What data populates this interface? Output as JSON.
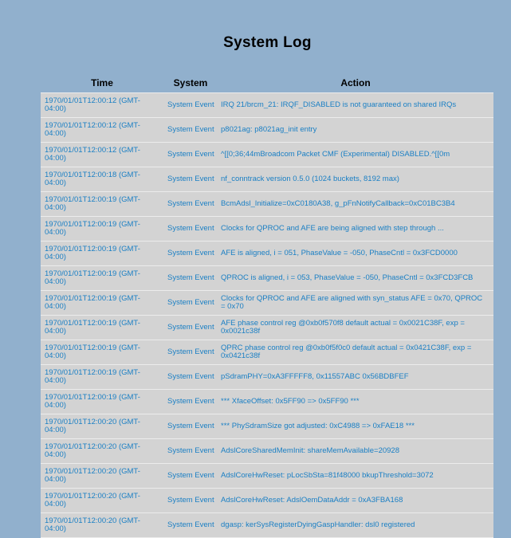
{
  "page": {
    "title": "System Log"
  },
  "table": {
    "headers": {
      "time": "Time",
      "system": "System",
      "action": "Action"
    },
    "rows": [
      {
        "time": "1970/01/01T12:00:12 (GMT-04:00)",
        "system": "System Event",
        "action": "IRQ 21/brcm_21: IRQF_DISABLED is not guaranteed on shared IRQs"
      },
      {
        "time": "1970/01/01T12:00:12 (GMT-04:00)",
        "system": "System Event",
        "action": "p8021ag: p8021ag_init entry"
      },
      {
        "time": "1970/01/01T12:00:12 (GMT-04:00)",
        "system": "System Event",
        "action": "^[[0;36;44mBroadcom Packet CMF (Experimental) DISABLED.^[[0m"
      },
      {
        "time": "1970/01/01T12:00:18 (GMT-04:00)",
        "system": "System Event",
        "action": "nf_conntrack version 0.5.0 (1024 buckets, 8192 max)"
      },
      {
        "time": "1970/01/01T12:00:19 (GMT-04:00)",
        "system": "System Event",
        "action": "BcmAdsl_Initialize=0xC0180A38, g_pFnNotifyCallback=0xC01BC3B4"
      },
      {
        "time": "1970/01/01T12:00:19 (GMT-04:00)",
        "system": "System Event",
        "action": "Clocks for QPROC and AFE are being aligned with step through ..."
      },
      {
        "time": "1970/01/01T12:00:19 (GMT-04:00)",
        "system": "System Event",
        "action": "AFE is aligned, i = 051, PhaseValue = -050, PhaseCntl = 0x3FCD0000"
      },
      {
        "time": "1970/01/01T12:00:19 (GMT-04:00)",
        "system": "System Event",
        "action": "QPROC is aligned, i = 053, PhaseValue = -050, PhaseCntl = 0x3FCD3FCB"
      },
      {
        "time": "1970/01/01T12:00:19 (GMT-04:00)",
        "system": "System Event",
        "action": "Clocks for QPROC and AFE are aligned with syn_status AFE = 0x70, QPROC = 0x70"
      },
      {
        "time": "1970/01/01T12:00:19 (GMT-04:00)",
        "system": "System Event",
        "action": "AFE phase control reg @0xb0f570f8 default actual = 0x0021C38F, exp = 0x0021c38f"
      },
      {
        "time": "1970/01/01T12:00:19 (GMT-04:00)",
        "system": "System Event",
        "action": "QPRC phase control reg @0xb0f5f0c0 default actual = 0x0421C38F, exp = 0x0421c38f"
      },
      {
        "time": "1970/01/01T12:00:19 (GMT-04:00)",
        "system": "System Event",
        "action": "pSdramPHY=0xA3FFFFF8, 0x11557ABC 0x56BDBFEF"
      },
      {
        "time": "1970/01/01T12:00:19 (GMT-04:00)",
        "system": "System Event",
        "action": "*** XfaceOffset: 0x5FF90 => 0x5FF90 ***"
      },
      {
        "time": "1970/01/01T12:00:20 (GMT-04:00)",
        "system": "System Event",
        "action": "*** PhySdramSize got adjusted: 0xC4988 => 0xFAE18 ***"
      },
      {
        "time": "1970/01/01T12:00:20 (GMT-04:00)",
        "system": "System Event",
        "action": "AdslCoreSharedMemInit: shareMemAvailable=20928"
      },
      {
        "time": "1970/01/01T12:00:20 (GMT-04:00)",
        "system": "System Event",
        "action": "AdslCoreHwReset: pLocSbSta=81f48000 bkupThreshold=3072"
      },
      {
        "time": "1970/01/01T12:00:20 (GMT-04:00)",
        "system": "System Event",
        "action": "AdslCoreHwReset: AdslOemDataAddr = 0xA3FBA168"
      },
      {
        "time": "1970/01/01T12:00:20 (GMT-04:00)",
        "system": "System Event",
        "action": "dgasp: kerSysRegisterDyingGaspHandler: dsl0 registered"
      }
    ]
  },
  "colors": {
    "background": "#91b0cd",
    "row_background": "#d3d3d3",
    "link_text": "#1a7fc4"
  }
}
